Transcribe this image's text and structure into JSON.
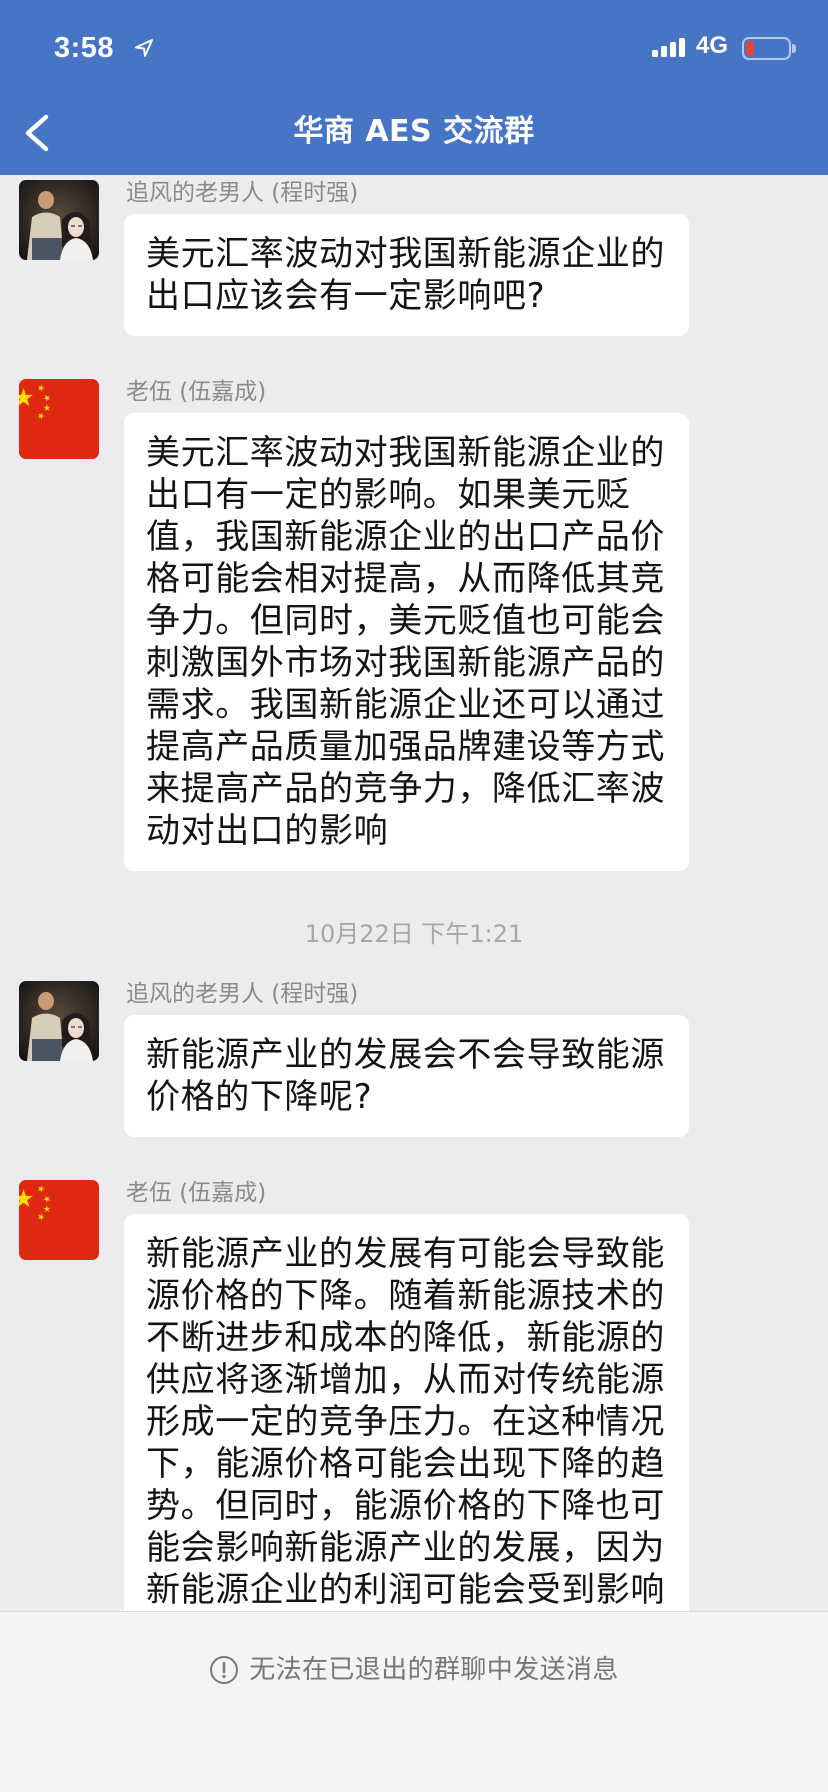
{
  "status_bar": {
    "time": "3:58",
    "network": "4G",
    "battery_level": 0.2,
    "signal_bars": 4,
    "icons": [
      "location-arrow-icon",
      "signal-bars-icon",
      "battery-icon"
    ]
  },
  "header": {
    "title": "华商 AES 交流群",
    "back_icon": "chevron-left-icon"
  },
  "colors": {
    "header_bg": "#4775c6",
    "chat_bg": "#ececef",
    "bubble_bg": "#ffffff",
    "footer_bg": "#f4f4f6",
    "battery_low": "#e5453b"
  },
  "chat": {
    "earlier": [
      {
        "sender": "追风的老男人 (程时强)",
        "avatar": "cartoon-portrait-icon",
        "lines": [
          "美元汇率波动对我国新能源企业的",
          "出口应该会有一定影响吧?"
        ]
      },
      {
        "sender": "老伍 (伍嘉成)",
        "avatar": "china-flag-icon",
        "lines": [
          "美元汇率波动对我国新能源企业的",
          "出口有一定的影响。如果美元贬",
          "值，我国新能源企业的出口产品价",
          "格可能会相对提高，从而降低其竞",
          "争力。但同时，美元贬值也可能会",
          "刺激国外市场对我国新能源产品的",
          "需求。我国新能源企业还可以通过",
          "提高产品质量加强品牌建设等方式",
          "来提高产品的竞争力，降低汇率波",
          "动对出口的影响"
        ]
      }
    ],
    "time_divider": "10月22日 下午1:21",
    "later": [
      {
        "sender": "追风的老男人 (程时强)",
        "avatar": "cartoon-portrait-icon",
        "lines": [
          "新能源产业的发展会不会导致能源",
          "价格的下降呢?"
        ]
      },
      {
        "sender": "老伍 (伍嘉成)",
        "avatar": "china-flag-icon",
        "lines": [
          "新能源产业的发展有可能会导致能",
          "源价格的下降。随着新能源技术的",
          "不断进步和成本的降低，新能源的",
          "供应将逐渐增加，从而对传统能源",
          "形成一定的竞争压力。在这种情况",
          "下，能源价格可能会出现下降的趋",
          "势。但同时，能源价格的下降也可",
          "能会影响新能源产业的发展，因为",
          "新能源企业的利润可能会受到影响"
        ]
      }
    ]
  },
  "footer": {
    "notice": "无法在已退出的群聊中发送消息",
    "icon": "exclamation-circle-icon"
  }
}
